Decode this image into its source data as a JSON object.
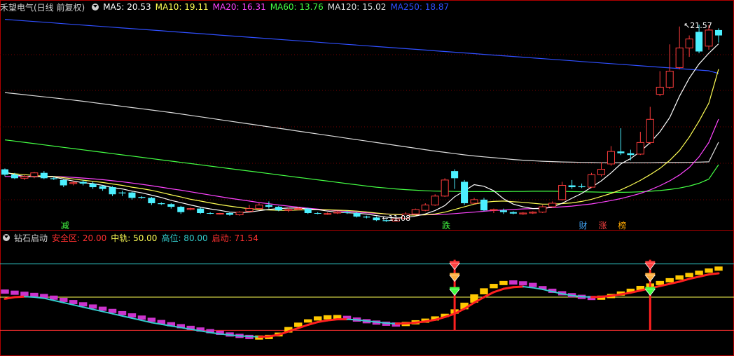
{
  "main_panel": {
    "title": "禾望电气(日线 前复权)",
    "ma_labels": [
      {
        "text": "MA5: 20.53",
        "color": "#ffffff"
      },
      {
        "text": "MA10: 19.11",
        "color": "#ffff55"
      },
      {
        "text": "MA20: 16.31",
        "color": "#ff44ff"
      },
      {
        "text": "MA60: 13.76",
        "color": "#44ff44"
      },
      {
        "text": "MA120: 15.02",
        "color": "#dddddd"
      },
      {
        "text": "MA250: 18.87",
        "color": "#2f4fff"
      }
    ],
    "high_label": "21.57",
    "low_label": "11.08",
    "markers": [
      "减",
      "跌",
      "财",
      "涨",
      "榜"
    ]
  },
  "indicator_panel": {
    "title": "钻石启动",
    "params": [
      {
        "text": "安全区: 20.00",
        "color": "#ff3030"
      },
      {
        "text": "中轨: 50.00",
        "color": "#ffff55"
      },
      {
        "text": "高位: 80.00",
        "color": "#33cccc"
      },
      {
        "text": "启动: 71.54",
        "color": "#ff3030"
      }
    ]
  },
  "chart_data": [
    {
      "type": "candlestick",
      "title": "禾望电气(日线 前复权)",
      "ylim": [
        10.5,
        22.2
      ],
      "annotations": {
        "high": 21.57,
        "low": 11.08
      },
      "colors": {
        "up": "#ff3c3c",
        "down": "#4cf0ff",
        "ma5": "#ffffff",
        "ma10": "#ffff55",
        "ma20": "#ff44ff",
        "ma60": "#44ff44",
        "ma120": "#dddddd",
        "ma250": "#2f4fff"
      },
      "candles": [
        [
          13.5,
          13.2,
          13.55,
          13.1
        ],
        [
          13.2,
          13.0,
          13.3,
          12.95
        ],
        [
          13.0,
          13.1,
          13.2,
          12.9
        ],
        [
          13.1,
          13.3,
          13.35,
          13.0
        ],
        [
          13.3,
          13.0,
          13.4,
          12.95
        ],
        [
          13.0,
          12.95,
          13.1,
          12.9
        ],
        [
          12.9,
          12.6,
          12.95,
          12.5
        ],
        [
          12.7,
          12.75,
          12.85,
          12.6
        ],
        [
          12.8,
          12.7,
          12.9,
          12.6
        ],
        [
          12.7,
          12.5,
          12.8,
          12.4
        ],
        [
          12.55,
          12.4,
          12.6,
          12.3
        ],
        [
          12.5,
          12.1,
          12.55,
          12.0
        ],
        [
          12.2,
          12.15,
          12.3,
          12.0
        ],
        [
          12.2,
          11.9,
          12.25,
          11.8
        ],
        [
          11.95,
          11.9,
          12.0,
          11.85
        ],
        [
          11.9,
          11.6,
          11.95,
          11.5
        ],
        [
          11.6,
          11.55,
          11.65,
          11.5
        ],
        [
          11.55,
          11.4,
          11.6,
          11.3
        ],
        [
          11.4,
          11.1,
          11.45,
          11.0
        ],
        [
          11.25,
          11.3,
          11.35,
          11.2
        ],
        [
          11.3,
          11.05,
          11.35,
          11.0
        ],
        [
          11.05,
          11.02,
          11.1,
          10.98
        ],
        [
          11.0,
          11.03,
          11.06,
          10.96
        ],
        [
          11.05,
          10.95,
          11.1,
          10.9
        ],
        [
          10.95,
          11.1,
          11.15,
          10.9
        ],
        [
          11.15,
          11.3,
          11.5,
          11.1
        ],
        [
          11.3,
          11.5,
          11.6,
          11.25
        ],
        [
          11.5,
          11.4,
          11.7,
          11.3
        ],
        [
          11.4,
          11.2,
          11.45,
          11.15
        ],
        [
          11.2,
          11.25,
          11.35,
          11.1
        ],
        [
          11.25,
          11.3,
          11.4,
          11.2
        ],
        [
          11.3,
          11.05,
          11.35,
          11.0
        ],
        [
          11.05,
          11.03,
          11.1,
          10.98
        ],
        [
          11.0,
          11.02,
          11.08,
          10.95
        ],
        [
          11.05,
          11.1,
          11.15,
          11.0
        ],
        [
          11.1,
          11.05,
          11.2,
          11.0
        ],
        [
          11.05,
          10.85,
          11.1,
          10.8
        ],
        [
          10.85,
          10.8,
          10.9,
          10.75
        ],
        [
          10.8,
          10.65,
          10.85,
          10.6
        ],
        [
          10.65,
          10.6,
          10.7,
          10.55
        ],
        [
          10.6,
          10.72,
          10.75,
          10.58
        ],
        [
          10.75,
          11.0,
          11.1,
          10.7
        ],
        [
          11.0,
          11.25,
          11.3,
          10.95
        ],
        [
          11.2,
          11.5,
          11.6,
          11.15
        ],
        [
          11.5,
          12.0,
          12.1,
          11.45
        ],
        [
          12.0,
          12.9,
          13.0,
          11.95
        ],
        [
          13.4,
          13.0,
          13.5,
          12.4
        ],
        [
          12.8,
          11.6,
          12.9,
          11.5
        ],
        [
          11.6,
          11.8,
          11.9,
          11.55
        ],
        [
          11.8,
          11.2,
          11.9,
          11.15
        ],
        [
          11.2,
          11.25,
          11.3,
          11.05
        ],
        [
          11.2,
          11.1,
          11.3,
          11.0
        ],
        [
          11.1,
          11.02,
          11.15,
          10.98
        ],
        [
          11.0,
          11.05,
          11.1,
          10.95
        ],
        [
          11.05,
          11.1,
          11.15,
          11.0
        ],
        [
          11.1,
          11.4,
          11.5,
          11.05
        ],
        [
          11.4,
          11.6,
          11.7,
          11.35
        ],
        [
          11.8,
          12.6,
          12.8,
          11.75
        ],
        [
          12.6,
          12.5,
          12.9,
          12.4
        ],
        [
          12.55,
          12.5,
          12.7,
          12.45
        ],
        [
          12.5,
          13.2,
          13.3,
          12.45
        ],
        [
          13.2,
          13.5,
          13.9,
          13.1
        ],
        [
          13.8,
          14.5,
          14.8,
          13.7
        ],
        [
          14.5,
          14.4,
          15.8,
          14.3
        ],
        [
          14.4,
          14.3,
          14.6,
          14.0
        ],
        [
          14.35,
          15.0,
          15.6,
          14.3
        ],
        [
          15.0,
          16.3,
          17.0,
          14.9
        ],
        [
          17.7,
          18.1,
          19.0,
          17.6
        ],
        [
          18.1,
          19.0,
          20.5,
          18.0
        ],
        [
          19.2,
          20.3,
          21.5,
          19.1
        ],
        [
          20.3,
          20.8,
          21.0,
          19.8
        ],
        [
          21.2,
          20.1,
          21.6,
          20.0
        ],
        [
          20.4,
          21.3,
          21.57,
          20.2
        ],
        [
          21.3,
          21.0,
          21.4,
          20.6
        ]
      ],
      "ma5": [
        13.35,
        13.2,
        13.1,
        13.08,
        13.1,
        13.07,
        12.95,
        12.84,
        12.75,
        12.7,
        12.6,
        12.48,
        12.4,
        12.28,
        12.18,
        12.05,
        11.92,
        11.76,
        11.63,
        11.5,
        11.38,
        11.28,
        11.2,
        11.1,
        11.07,
        11.1,
        11.18,
        11.25,
        11.3,
        11.33,
        11.33,
        11.28,
        11.24,
        11.16,
        11.1,
        11.06,
        11.04,
        10.99,
        10.91,
        10.82,
        10.77,
        10.79,
        10.88,
        11.0,
        11.19,
        11.47,
        11.96,
        12.3,
        12.64,
        12.55,
        12.3,
        11.85,
        11.55,
        11.4,
        11.3,
        11.3,
        11.38,
        11.6,
        11.88,
        12.15,
        12.5,
        12.85,
        13.3,
        13.8,
        14.1,
        14.5,
        15.0,
        15.6,
        16.4,
        17.6,
        18.6,
        19.4,
        20.0,
        20.53
      ],
      "ma10": [
        13.3,
        13.25,
        13.2,
        13.15,
        13.12,
        13.1,
        13.03,
        12.96,
        12.89,
        12.83,
        12.76,
        12.68,
        12.6,
        12.5,
        12.42,
        12.32,
        12.2,
        12.07,
        11.95,
        11.82,
        11.72,
        11.62,
        11.52,
        11.44,
        11.36,
        11.29,
        11.25,
        11.22,
        11.2,
        11.2,
        11.22,
        11.23,
        11.24,
        11.23,
        11.21,
        11.19,
        11.16,
        11.11,
        11.05,
        11.0,
        10.97,
        10.94,
        10.93,
        10.95,
        11.0,
        11.1,
        11.25,
        11.4,
        11.55,
        11.65,
        11.7,
        11.72,
        11.68,
        11.65,
        11.6,
        11.55,
        11.55,
        11.58,
        11.62,
        11.7,
        11.82,
        11.98,
        12.15,
        12.35,
        12.6,
        12.88,
        13.2,
        13.55,
        14.0,
        14.55,
        15.3,
        16.2,
        17.2,
        19.11
      ],
      "ma20": [
        13.1,
        13.1,
        13.1,
        13.12,
        13.12,
        13.1,
        13.08,
        13.05,
        13.01,
        12.97,
        12.92,
        12.86,
        12.8,
        12.73,
        12.66,
        12.58,
        12.5,
        12.41,
        12.33,
        12.24,
        12.15,
        12.06,
        11.97,
        11.88,
        11.8,
        11.72,
        11.64,
        11.57,
        11.5,
        11.44,
        11.38,
        11.32,
        11.27,
        11.22,
        11.18,
        11.14,
        11.1,
        11.06,
        11.03,
        11.0,
        10.98,
        10.96,
        10.95,
        10.95,
        10.96,
        10.98,
        11.02,
        11.06,
        11.1,
        11.15,
        11.19,
        11.22,
        11.25,
        11.28,
        11.3,
        11.33,
        11.36,
        11.4,
        11.44,
        11.5,
        11.56,
        11.65,
        11.75,
        11.86,
        12.0,
        12.15,
        12.35,
        12.58,
        12.85,
        13.18,
        13.6,
        14.2,
        15.0,
        16.31
      ],
      "ma60": [
        15.15,
        15.08,
        15.01,
        14.94,
        14.87,
        14.8,
        14.73,
        14.66,
        14.59,
        14.52,
        14.45,
        14.38,
        14.31,
        14.24,
        14.17,
        14.1,
        14.03,
        13.96,
        13.89,
        13.82,
        13.75,
        13.68,
        13.61,
        13.54,
        13.47,
        13.4,
        13.33,
        13.26,
        13.19,
        13.12,
        13.05,
        12.98,
        12.91,
        12.84,
        12.77,
        12.7,
        12.63,
        12.56,
        12.5,
        12.45,
        12.4,
        12.36,
        12.33,
        12.3,
        12.28,
        12.27,
        12.26,
        12.25,
        12.25,
        12.25,
        12.25,
        12.25,
        12.26,
        12.26,
        12.27,
        12.27,
        12.27,
        12.26,
        12.25,
        12.24,
        12.23,
        12.22,
        12.21,
        12.21,
        12.22,
        12.24,
        12.27,
        12.31,
        12.37,
        12.45,
        12.56,
        12.72,
        12.95,
        13.76
      ],
      "ma120": [
        17.8,
        17.74,
        17.68,
        17.62,
        17.56,
        17.5,
        17.44,
        17.38,
        17.31,
        17.24,
        17.17,
        17.1,
        17.03,
        16.96,
        16.89,
        16.82,
        16.75,
        16.68,
        16.6,
        16.52,
        16.44,
        16.36,
        16.28,
        16.2,
        16.12,
        16.04,
        15.96,
        15.88,
        15.8,
        15.72,
        15.64,
        15.56,
        15.48,
        15.4,
        15.32,
        15.24,
        15.16,
        15.08,
        15.0,
        14.92,
        14.84,
        14.76,
        14.68,
        14.6,
        14.52,
        14.45,
        14.38,
        14.31,
        14.25,
        14.2,
        14.15,
        14.1,
        14.05,
        14.01,
        13.98,
        13.95,
        13.93,
        13.91,
        13.9,
        13.89,
        13.88,
        13.87,
        13.87,
        13.87,
        13.87,
        13.87,
        13.87,
        13.88,
        13.88,
        13.88,
        13.89,
        13.9,
        13.92,
        15.02
      ],
      "ma250": [
        21.9,
        21.86,
        21.82,
        21.78,
        21.74,
        21.7,
        21.66,
        21.62,
        21.58,
        21.54,
        21.5,
        21.46,
        21.42,
        21.38,
        21.34,
        21.3,
        21.26,
        21.22,
        21.18,
        21.14,
        21.1,
        21.06,
        21.02,
        20.98,
        20.94,
        20.9,
        20.86,
        20.82,
        20.78,
        20.74,
        20.7,
        20.66,
        20.62,
        20.58,
        20.54,
        20.5,
        20.46,
        20.42,
        20.38,
        20.34,
        20.3,
        20.26,
        20.22,
        20.18,
        20.14,
        20.1,
        20.06,
        20.02,
        19.98,
        19.94,
        19.9,
        19.86,
        19.82,
        19.78,
        19.74,
        19.7,
        19.66,
        19.62,
        19.58,
        19.54,
        19.5,
        19.46,
        19.42,
        19.38,
        19.34,
        19.3,
        19.26,
        19.22,
        19.18,
        19.14,
        19.1,
        19.06,
        19.02,
        18.87
      ]
    },
    {
      "type": "bar",
      "title": "钻石启动",
      "ylim": [
        0,
        100
      ],
      "reference_lines": [
        {
          "name": "安全区",
          "value": 20,
          "color": "#ff3030"
        },
        {
          "name": "中轨",
          "value": 50,
          "color": "#ffff55"
        },
        {
          "name": "高位",
          "value": 80,
          "color": "#33cccc"
        }
      ],
      "signal_line": {
        "name": "启动",
        "value": 71.54,
        "color": "#ff2020"
      },
      "signals_at": [
        46,
        66
      ],
      "values": [
        54.5,
        53.5,
        52.5,
        51.5,
        50.5,
        48.5,
        46.5,
        44.5,
        42.5,
        40.5,
        38.5,
        36.5,
        34.5,
        32.5,
        30.5,
        28.5,
        26.5,
        24.5,
        23.0,
        21.5,
        20.0,
        18.5,
        17.0,
        15.5,
        14.5,
        13.5,
        13.5,
        14.5,
        18.0,
        23.0,
        27.0,
        30.0,
        31.5,
        32.0,
        32.0,
        30.5,
        29.0,
        27.5,
        26.5,
        25.5,
        25.0,
        26.5,
        28.0,
        29.5,
        32.0,
        35.0,
        39.0,
        45.0,
        52.5,
        58.0,
        62.0,
        63.5,
        63.0,
        62.0,
        60.0,
        57.0,
        54.5,
        52.5,
        51.0,
        49.5,
        49.0,
        50.0,
        52.0,
        54.5,
        57.0,
        59.5,
        61.5,
        64.0,
        66.5,
        69.0,
        71.0,
        73.0,
        75.0,
        76.5
      ],
      "trend_line": [
        48.5,
        50.0,
        50.5,
        50.0,
        49.0,
        47.0,
        45.0,
        43.0,
        41.0,
        39.0,
        37.0,
        35.0,
        33.0,
        31.0,
        29.0,
        27.0,
        25.5,
        24.0,
        22.5,
        21.0,
        19.5,
        18.0,
        16.8,
        15.8,
        15.0,
        14.5,
        14.2,
        14.5,
        16.0,
        19.0,
        22.0,
        25.0,
        27.5,
        29.0,
        30.0,
        30.0,
        29.5,
        28.5,
        27.5,
        26.5,
        26.0,
        26.3,
        27.0,
        28.0,
        29.5,
        32.0,
        35.0,
        39.5,
        45.0,
        50.0,
        54.5,
        57.5,
        59.0,
        59.5,
        58.5,
        57.0,
        55.0,
        53.0,
        51.5,
        50.5,
        50.0,
        50.3,
        51.2,
        52.5,
        54.0,
        56.0,
        58.0,
        60.0,
        62.0,
        64.0,
        66.5,
        68.5,
        70.5,
        71.54
      ],
      "bar_colors": {
        "rising": "#ffc800",
        "falling": "#cc33cc"
      },
      "trend_colors": {
        "rising": "#ff2020",
        "falling": "#33cccc"
      }
    }
  ]
}
